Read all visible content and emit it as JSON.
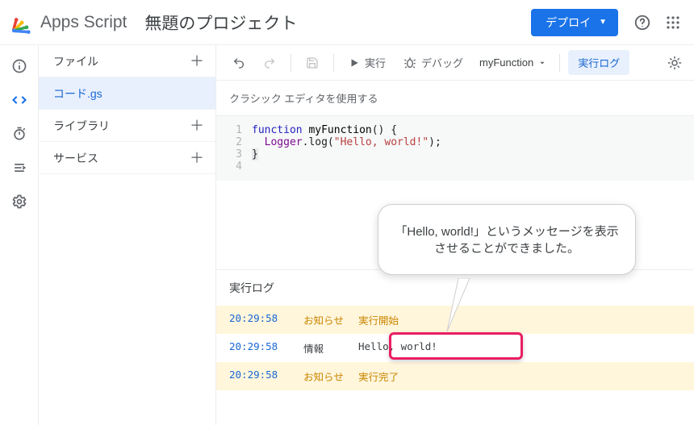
{
  "header": {
    "brand": "Apps Script",
    "project": "無題のプロジェクト",
    "deploy": "デプロイ"
  },
  "sidebar": {
    "files": "ファイル",
    "file_item": "コード.gs",
    "libraries": "ライブラリ",
    "services": "サービス"
  },
  "toolbar": {
    "run": "実行",
    "debug": "デバッグ",
    "fn": "myFunction",
    "log": "実行ログ"
  },
  "classic": "クラシック エディタを使用する",
  "code": {
    "ln1": "1",
    "ln2": "2",
    "ln3": "3",
    "ln4": "4",
    "kw_function": "function",
    "fn_name": "myFunction",
    "paren_open": "() {",
    "logger": "Logger",
    "dot_log": ".log(",
    "str": "\"Hello, world!\"",
    "close_paren": ");",
    "close_brace": "}"
  },
  "log": {
    "title": "実行ログ",
    "rows": [
      {
        "time": "20:29:58",
        "type": "お知らせ",
        "msg": "実行開始",
        "kind": "notice"
      },
      {
        "time": "20:29:58",
        "type": "情報",
        "msg": "Hello, world!",
        "kind": "info"
      },
      {
        "time": "20:29:58",
        "type": "お知らせ",
        "msg": "実行完了",
        "kind": "notice"
      }
    ]
  },
  "callout": "「Hello, world!」というメッセージを表示させることができました。"
}
